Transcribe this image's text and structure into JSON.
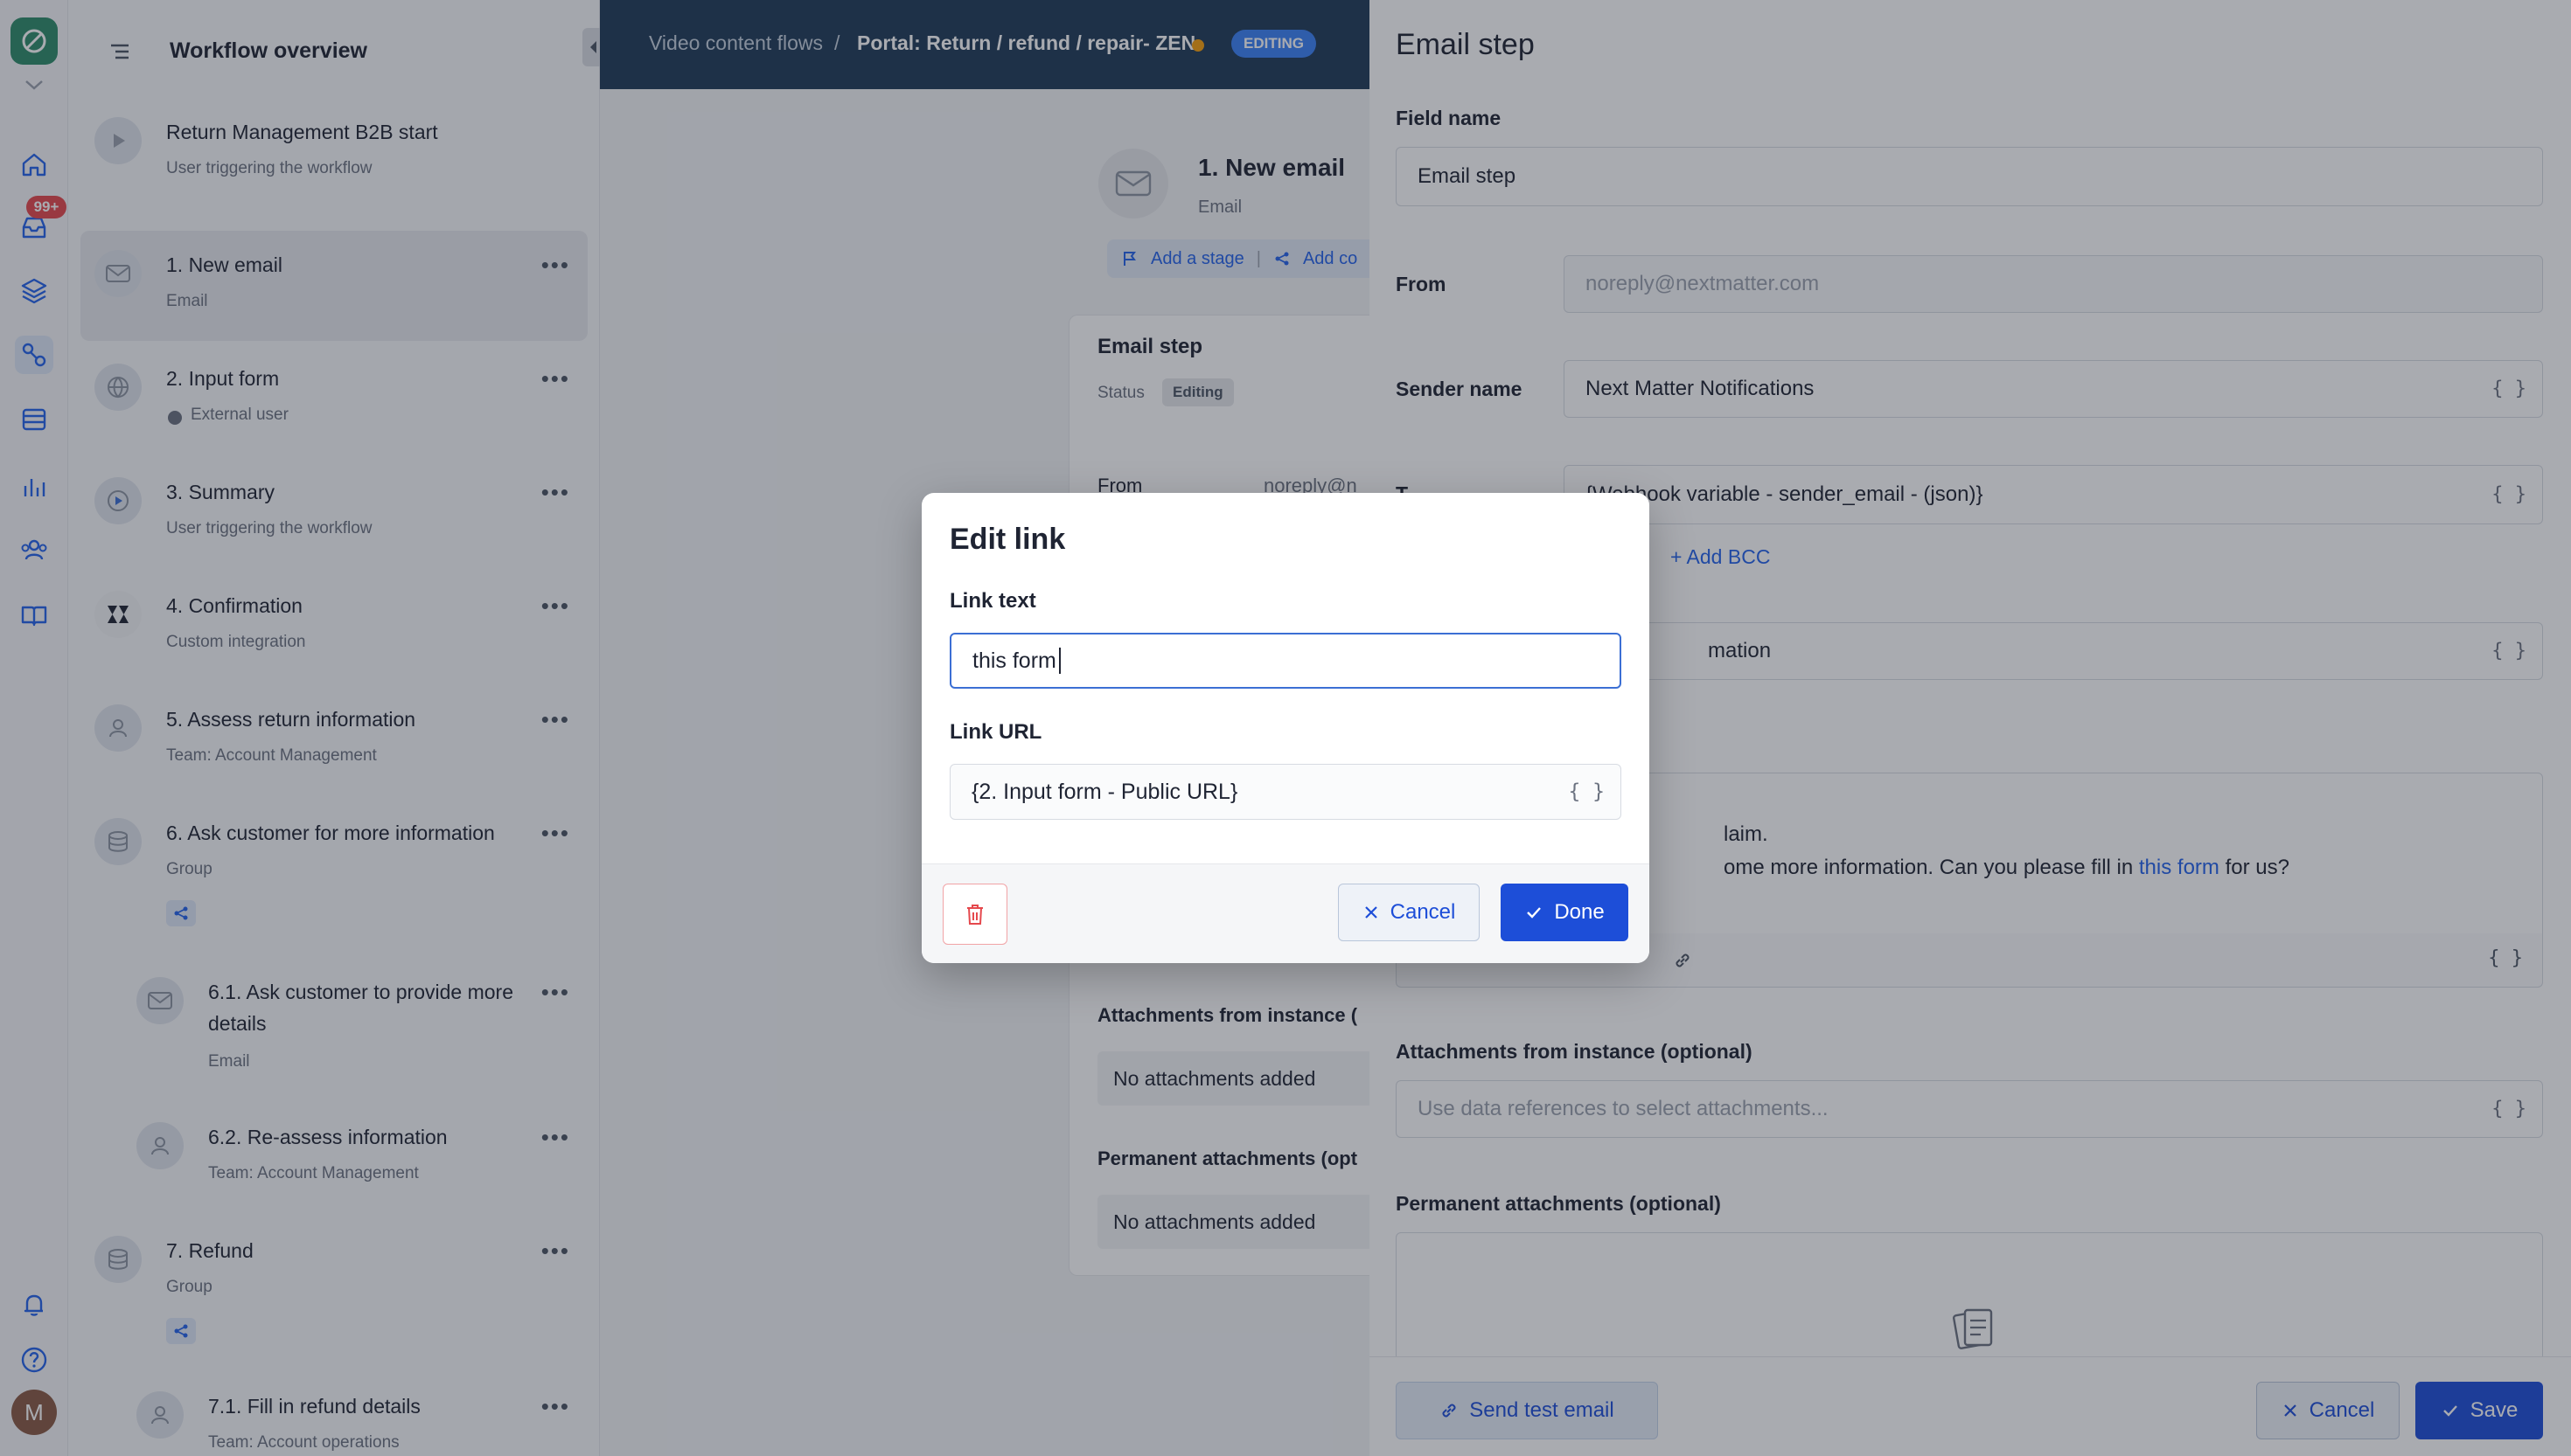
{
  "sidebar": {
    "title": "Workflow overview",
    "notification_badge": "99+",
    "avatar_initial": "M",
    "steps": [
      {
        "name": "Return Management B2B start",
        "sub": "User triggering the workflow"
      },
      {
        "name": "1. New email",
        "sub": "Email"
      },
      {
        "name": "2. Input form",
        "sub": "External user"
      },
      {
        "name": "3. Summary",
        "sub": "User triggering the workflow"
      },
      {
        "name": "4. Confirmation",
        "sub": "Custom integration"
      },
      {
        "name": "5. Assess return information",
        "sub": "Team: Account Management"
      },
      {
        "name": "6. Ask customer for more information",
        "sub": "Group"
      },
      {
        "name": "6.1. Ask customer to provide more",
        "name2": "details",
        "sub": "Email"
      },
      {
        "name": "6.2. Re-assess information",
        "sub": "Team: Account Management"
      },
      {
        "name": "7. Refund",
        "sub": "Group"
      },
      {
        "name": "7.1. Fill in refund details",
        "sub": "Team: Account operations"
      }
    ]
  },
  "topbar": {
    "breadcrumb_parent": "Video content flows",
    "breadcrumb_sep": "/",
    "breadcrumb_current": "Portal: Return / refund / repair- ZEN",
    "status_pill": "EDITING"
  },
  "canvas": {
    "node_title": "1. New email",
    "node_sub": "Email",
    "add_stage": "Add a stage",
    "add_connection": "Add co",
    "card_title": "Email step",
    "status_label": "Status",
    "status_value": "Editing",
    "from_label": "From",
    "from_value": "noreply@n",
    "attachments_instance_label": "Attachments from instance (",
    "no_attachments_1": "No attachments added",
    "permanent_attachments_label": "Permanent attachments (opt",
    "no_attachments_2": "No attachments added"
  },
  "drawer": {
    "title": "Email step",
    "field_name_label": "Field name",
    "field_name_value": "Email step",
    "from_label": "From",
    "from_placeholder": "noreply@nextmatter.com",
    "sender_name_label": "Sender name",
    "sender_name_value": "Next Matter Notifications",
    "to_label": "T",
    "to_value": "{Webhook variable - sender_email - (json)}",
    "add_bcc": "+ Add BCC",
    "subject_fragment": "mation",
    "body_line1": "laim.",
    "body_line2_before": "ome more information. Can you please fill in ",
    "body_link": "this form",
    "body_line2_after": " for us?",
    "attachments_instance_label": "Attachments from instance (optional)",
    "attachments_instance_placeholder": "Use data references to select attachments...",
    "permanent_attachments_label": "Permanent attachments (optional)",
    "send_test_email": "Send test email",
    "cancel": "Cancel",
    "save": "Save",
    "brace": "{ }"
  },
  "modal": {
    "title": "Edit link",
    "link_text_label": "Link text",
    "link_text_value": "this form",
    "link_url_label": "Link URL",
    "link_url_value": "{2. Input form - Public URL}",
    "brace": "{ }",
    "cancel": "Cancel",
    "done": "Done"
  },
  "colors": {
    "primary": "#1d4ed8",
    "link": "#2563eb",
    "topbar": "#1f3a57",
    "badge": "#e5484d",
    "logo": "#2e8b6a",
    "dirty_dot": "#f59e0b",
    "danger_border": "#f1a3a6"
  }
}
